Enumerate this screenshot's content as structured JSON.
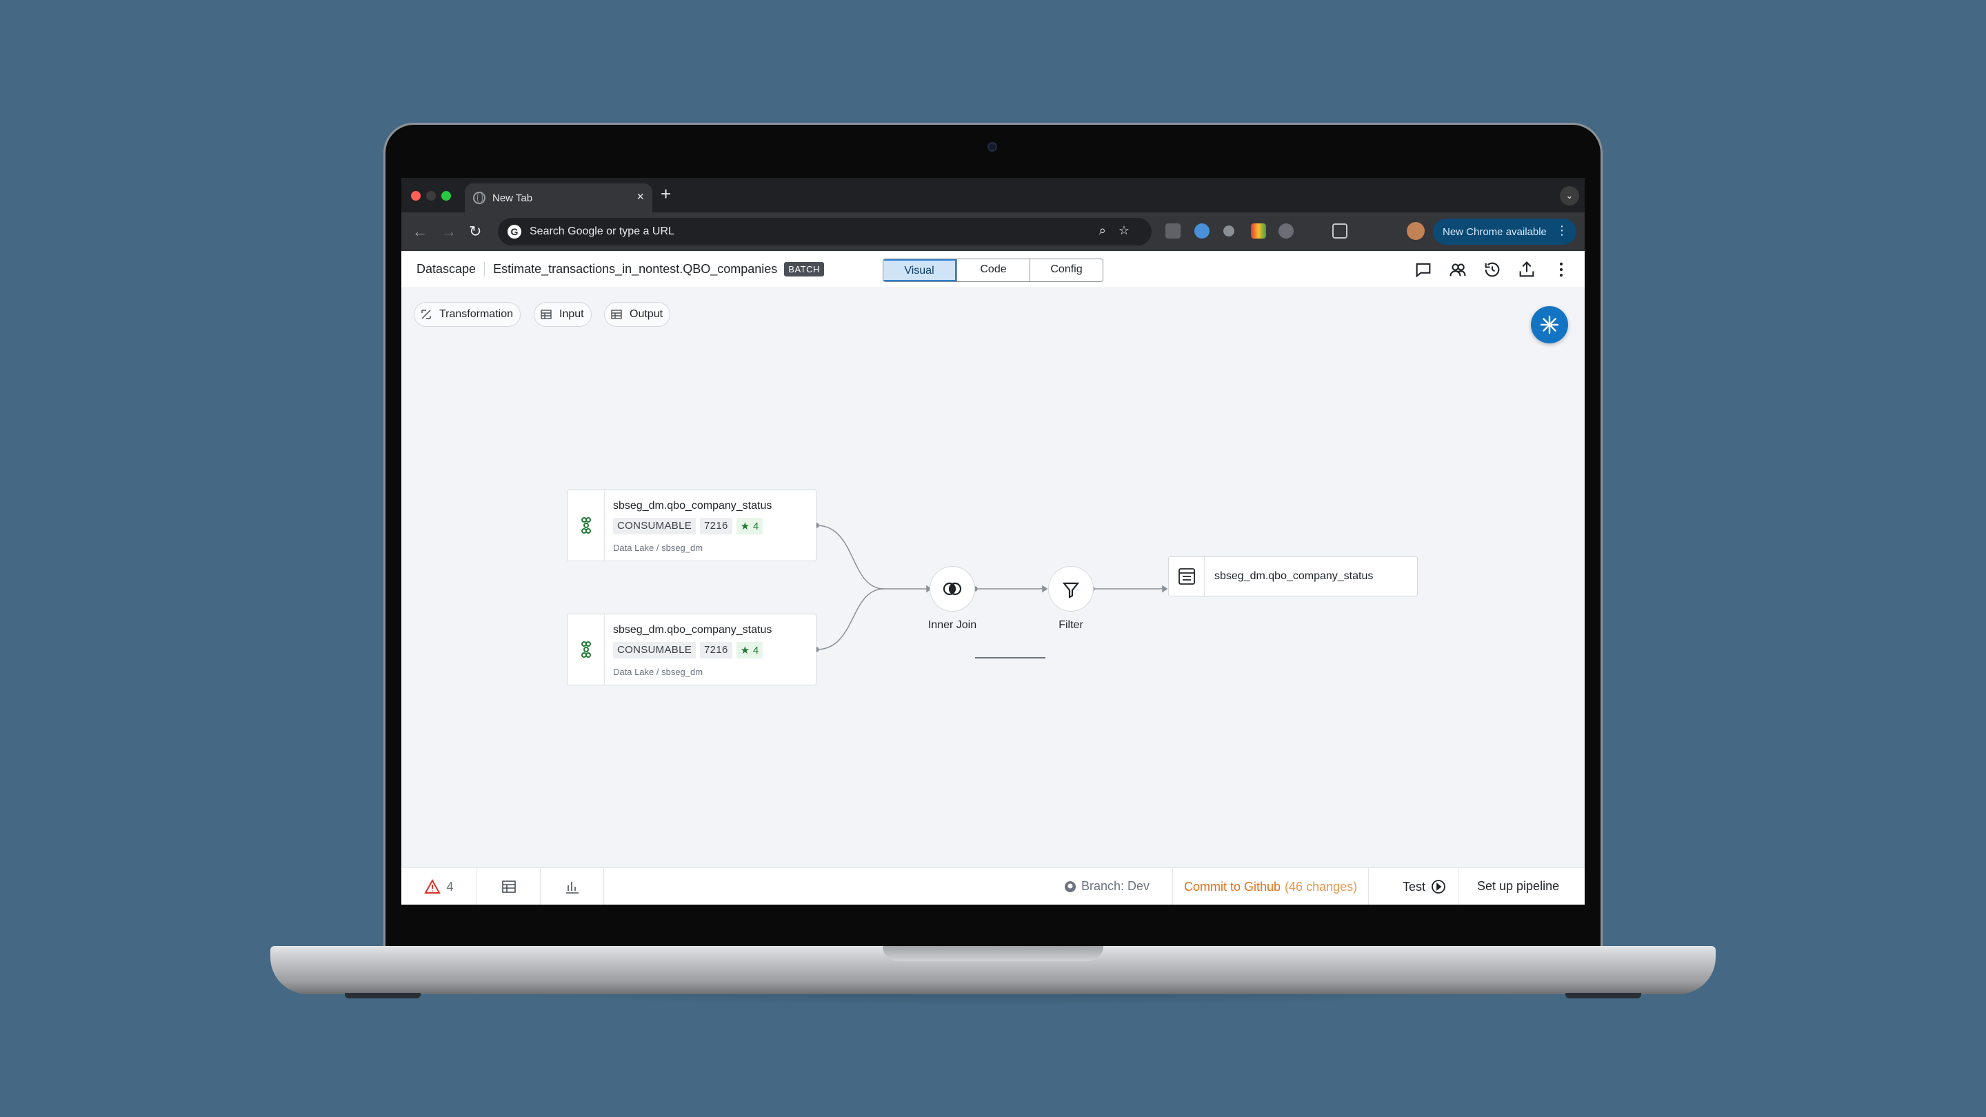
{
  "browser": {
    "tab_title": "New Tab",
    "new_tab_symbol": "+",
    "close_symbol": "×",
    "omnibox_placeholder": "Search Google or type a URL",
    "update_button": "New Chrome available"
  },
  "app": {
    "brand": "Datascape",
    "pipeline_name": "Estimate_transactions_in_nontest.QBO_companies",
    "mode_badge": "BATCH",
    "view_tabs": [
      "Visual",
      "Code",
      "Config"
    ],
    "active_view": "Visual"
  },
  "palette": {
    "chips": [
      "Transformation",
      "Input",
      "Output"
    ]
  },
  "graph": {
    "sources": [
      {
        "name": "sbseg_dm.qbo_company_status",
        "badge": "CONSUMABLE",
        "count": "7216",
        "stars": "★ 4",
        "path": "Data Lake / sbseg_dm"
      },
      {
        "name": "sbseg_dm.qbo_company_status",
        "badge": "CONSUMABLE",
        "count": "7216",
        "stars": "★ 4",
        "path": "Data Lake / sbseg_dm"
      }
    ],
    "join_label": "Inner Join",
    "filter_label": "Filter",
    "output_name": "sbseg_dm.qbo_company_status"
  },
  "statusbar": {
    "warning_count": "4",
    "branch": "Branch: Dev",
    "commit": "Commit to Github",
    "commit_changes": "(46 changes)",
    "test": "Test",
    "setup": "Set up pipeline"
  },
  "colors": {
    "background": "#456985",
    "accent": "#2d7fc9",
    "fab": "#1474c4",
    "commit": "#e0701a",
    "warning": "#d93025",
    "consumable_icon": "#1f7a34"
  }
}
